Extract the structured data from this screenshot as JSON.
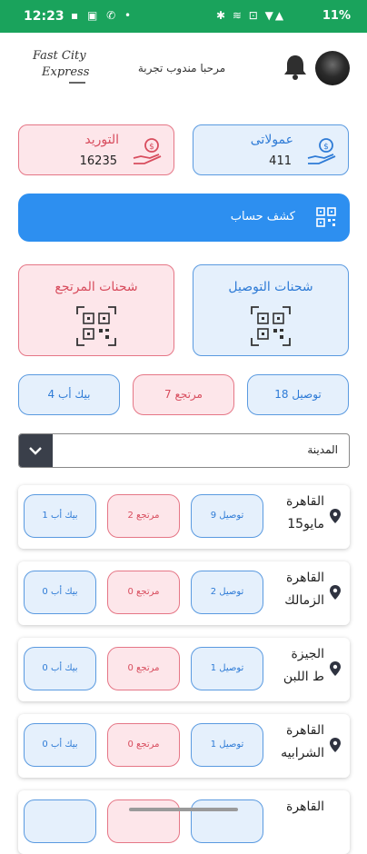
{
  "status_bar": {
    "time": "12:23",
    "left_icons": "▪ ▣ ✆ •",
    "right_icons": "✱ ≋ ⊡ ▼▲",
    "battery": "11%"
  },
  "header": {
    "logo_line1": "Fast City",
    "logo_line2": "Express",
    "welcome_text": "مرحبا مندوب تجربة"
  },
  "stats": {
    "commissions": {
      "label": "عمولاتى",
      "value": "411"
    },
    "supply": {
      "label": "التوريد",
      "value": "16235"
    }
  },
  "statement": {
    "label": "كشف حساب"
  },
  "shipments": {
    "delivery": {
      "label": "شحنات التوصيل"
    },
    "returns": {
      "label": "شحنات المرتجع"
    }
  },
  "summary_pills": {
    "delivery": "توصيل 18",
    "returns": "مرتجع 7",
    "pickup": "بيك أب 4"
  },
  "city_select": {
    "value": "المدينة"
  },
  "cities": [
    {
      "name": "القاهرة",
      "area": "15مايو",
      "delivery": "توصيل 9",
      "returns": "مرتجع 2",
      "pickup": "بيك أب 1"
    },
    {
      "name": "القاهرة",
      "area": "الزمالك",
      "delivery": "توصيل 2",
      "returns": "مرتجع 0",
      "pickup": "بيك أب 0"
    },
    {
      "name": "الجيزة",
      "area": "ط اللبن",
      "delivery": "توصيل 1",
      "returns": "مرتجع 0",
      "pickup": "بيك أب 0"
    },
    {
      "name": "القاهرة",
      "area": "الشرابيه",
      "delivery": "توصيل 1",
      "returns": "مرتجع 0",
      "pickup": "بيك أب 0"
    },
    {
      "name": "القاهرة",
      "area": "",
      "delivery": "",
      "returns": "",
      "pickup": ""
    }
  ],
  "colors": {
    "status_bar": "#1aa35c",
    "primary_blue": "#2d8ff0",
    "blue_card_bg": "#e5f0fc",
    "red_card_bg": "#fde6ea",
    "red_text": "#d84d5e",
    "blue_text": "#2e7bd6"
  },
  "icons": {
    "bell": "bell-icon",
    "money_hand": "money-hand-icon",
    "qr": "qr-code-icon",
    "pin": "location-pin-icon",
    "chevron": "chevron-down-icon"
  }
}
